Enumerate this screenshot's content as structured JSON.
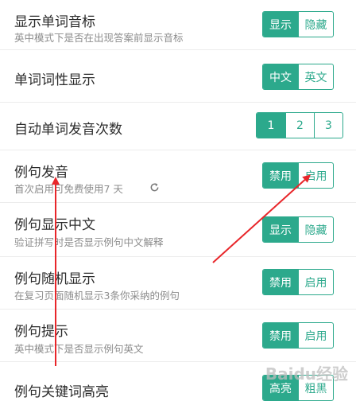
{
  "settings": {
    "phonetic": {
      "title": "显示单词音标",
      "subtitle": "英中模式下是否在出现答案前显示音标",
      "options": [
        "显示",
        "隐藏"
      ],
      "selected": "显示"
    },
    "part_of_speech": {
      "title": "单词词性显示",
      "options": [
        "中文",
        "英文"
      ],
      "selected": "中文"
    },
    "auto_pronounce_count": {
      "title": "自动单词发音次数",
      "options": [
        "1",
        "2",
        "3"
      ],
      "selected": "1"
    },
    "sentence_audio": {
      "title": "例句发音",
      "subtitle": "首次启用可免费使用7 天",
      "options": [
        "禁用",
        "启用"
      ],
      "selected": "禁用"
    },
    "sentence_chinese": {
      "title": "例句显示中文",
      "subtitle": "验证拼写时是否显示例句中文解释",
      "options": [
        "显示",
        "隐藏"
      ],
      "selected": "显示"
    },
    "random_sentence": {
      "title": "例句随机显示",
      "subtitle": "在复习页面随机显示3条你采纳的例句",
      "options": [
        "禁用",
        "启用"
      ],
      "selected": "禁用"
    },
    "sentence_hint": {
      "title": "例句提示",
      "subtitle": "英中模式下是否显示例句英文",
      "options": [
        "禁用",
        "启用"
      ],
      "selected": "禁用"
    },
    "keyword_highlight": {
      "title": "例句关键词高亮",
      "options": [
        "高亮",
        "粗黑"
      ],
      "selected": "高亮"
    }
  },
  "watermark": "Baidu经验",
  "colors": {
    "accent": "#2ca98c",
    "annotation_arrow": "#e8262a"
  },
  "icons": {
    "refresh": "refresh-icon"
  }
}
